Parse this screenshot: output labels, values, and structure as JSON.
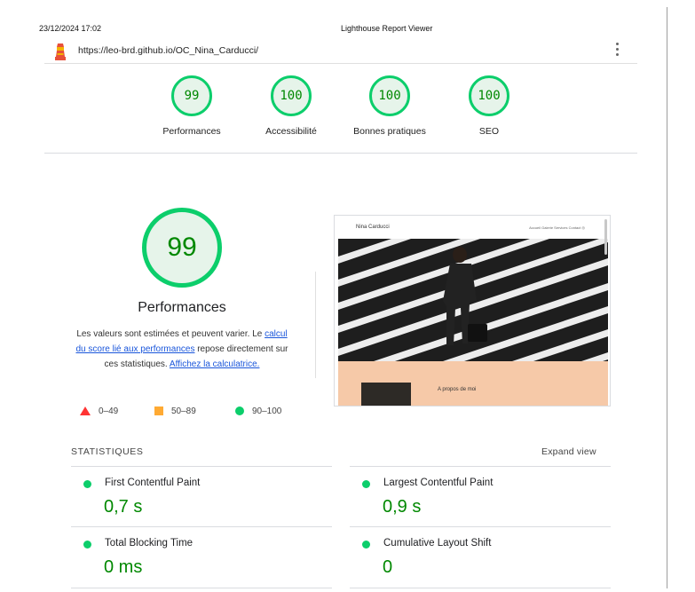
{
  "print_header": {
    "datetime": "23/12/2024 17:02",
    "title": "Lighthouse Report Viewer"
  },
  "url_bar": {
    "url": "https://leo-brd.github.io/OC_Nina_Carducci/",
    "logo_icon": "lighthouse-icon",
    "menu_icon": "kebab-menu-icon"
  },
  "summary_gauges": [
    {
      "score": "99",
      "label": "Performances"
    },
    {
      "score": "100",
      "label": "Accessibilité"
    },
    {
      "score": "100",
      "label": "Bonnes pratiques"
    },
    {
      "score": "100",
      "label": "SEO"
    }
  ],
  "performance": {
    "score": "99",
    "title": "Performances",
    "desc_prefix": "Les valeurs sont estimées et peuvent varier. Le ",
    "desc_link1": "calcul du score lié aux performances",
    "desc_mid": " repose directement sur ces statistiques. ",
    "desc_link2": "Affichez la calculatrice.",
    "legend": [
      {
        "icon": "fail-triangle-icon",
        "range": "0–49",
        "color": "#ff3333"
      },
      {
        "icon": "average-square-icon",
        "range": "50–89",
        "color": "#ffaa33"
      },
      {
        "icon": "pass-circle-icon",
        "range": "90–100",
        "color": "#0cce6b"
      }
    ]
  },
  "screenshot": {
    "brand": "Nina Carducci",
    "nav": "Accueil  Galerie  Services  Contact  ◎",
    "section_title": "A propos de moi"
  },
  "stats": {
    "heading": "STATISTIQUES",
    "expand_label": "Expand view",
    "metrics": [
      {
        "name": "First Contentful Paint",
        "value": "0,7 s"
      },
      {
        "name": "Largest Contentful Paint",
        "value": "0,9 s"
      },
      {
        "name": "Total Blocking Time",
        "value": "0 ms"
      },
      {
        "name": "Cumulative Layout Shift",
        "value": "0"
      }
    ]
  },
  "colors": {
    "pass": "#0cce6b",
    "pass_text": "#008800",
    "average": "#ffaa33",
    "fail": "#ff3333",
    "link": "#1a56db"
  }
}
